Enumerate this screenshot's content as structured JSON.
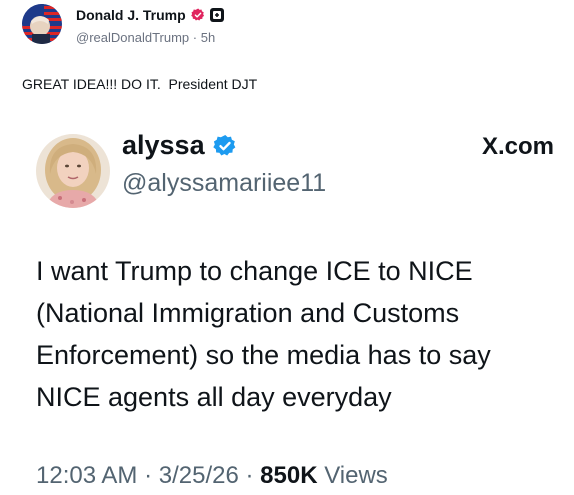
{
  "post": {
    "author_name": "Donald J. Trump",
    "handle": "@realDonaldTrump",
    "separator": "·",
    "time_ago": "5h",
    "text": "GREAT IDEA!!! DO IT.  President DJT"
  },
  "quoted": {
    "name": "alyssa",
    "handle": "@alyssamariiee11",
    "brand": "X.com",
    "lines": [
      "I want Trump to change ICE to NICE",
      "(National Immigration and Customs",
      "Enforcement) so the media has to say",
      "NICE agents all day everyday"
    ],
    "time": "12:03 AM",
    "date": "3/25/26",
    "views_count": "850K",
    "views_label": "Views"
  },
  "colors": {
    "verified_pink": "#e0245e",
    "verified_blue": "#1d9bf0",
    "text": "#0f1419",
    "muted": "#536471"
  },
  "icons": {
    "author_badge": "verified-badge-icon",
    "affiliate_badge": "affiliate-badge-icon",
    "quoted_badge": "verified-badge-icon",
    "brand": "x-logo-icon"
  }
}
